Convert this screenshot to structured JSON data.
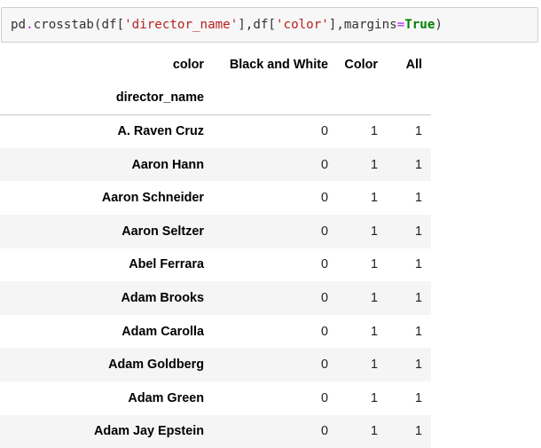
{
  "code_cell": {
    "tokens": [
      {
        "text": "pd",
        "cls": "tok-obj"
      },
      {
        "text": ".",
        "cls": "tok-op"
      },
      {
        "text": "crosstab(df[",
        "cls": "tok-obj"
      },
      {
        "text": "'director_name'",
        "cls": "tok-str"
      },
      {
        "text": "],df[",
        "cls": "tok-obj"
      },
      {
        "text": "'color'",
        "cls": "tok-str"
      },
      {
        "text": "],margins",
        "cls": "tok-obj"
      },
      {
        "text": "=",
        "cls": "tok-op"
      },
      {
        "text": "True",
        "cls": "tok-kw"
      },
      {
        "text": ")",
        "cls": "tok-obj"
      }
    ]
  },
  "table": {
    "columns_label": "color",
    "index_label": "director_name",
    "columns": [
      "Black and White",
      "Color",
      "All"
    ],
    "rows": [
      {
        "name": "A. Raven Cruz",
        "values": [
          "0",
          "1",
          "1"
        ]
      },
      {
        "name": "Aaron Hann",
        "values": [
          "0",
          "1",
          "1"
        ]
      },
      {
        "name": "Aaron Schneider",
        "values": [
          "0",
          "1",
          "1"
        ]
      },
      {
        "name": "Aaron Seltzer",
        "values": [
          "0",
          "1",
          "1"
        ]
      },
      {
        "name": "Abel Ferrara",
        "values": [
          "0",
          "1",
          "1"
        ]
      },
      {
        "name": "Adam Brooks",
        "values": [
          "0",
          "1",
          "1"
        ]
      },
      {
        "name": "Adam Carolla",
        "values": [
          "0",
          "1",
          "1"
        ]
      },
      {
        "name": "Adam Goldberg",
        "values": [
          "0",
          "1",
          "1"
        ]
      },
      {
        "name": "Adam Green",
        "values": [
          "0",
          "1",
          "1"
        ]
      },
      {
        "name": "Adam Jay Epstein",
        "values": [
          "0",
          "1",
          "1"
        ]
      }
    ]
  }
}
